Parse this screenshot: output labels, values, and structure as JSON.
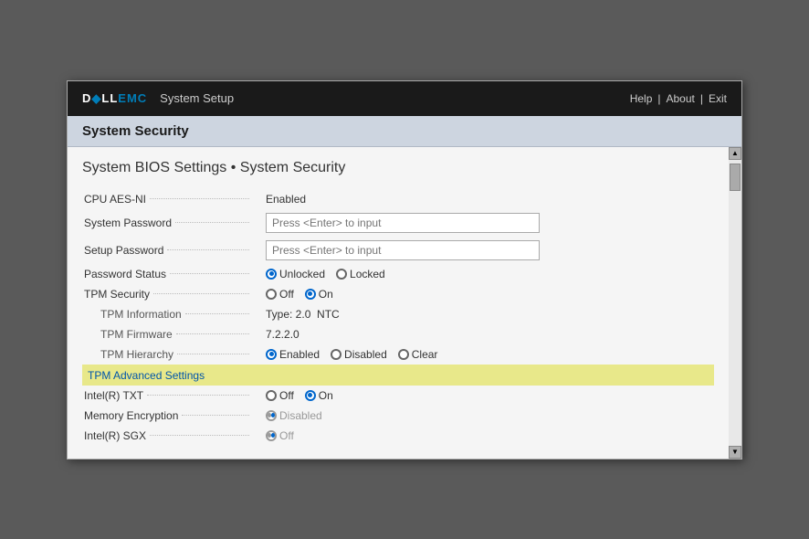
{
  "header": {
    "logo_dell": "DELL",
    "logo_emc": "EMC",
    "system_setup": "System Setup",
    "nav_help": "Help",
    "nav_about": "About",
    "nav_exit": "Exit"
  },
  "section_title": "System Security",
  "page_title": "System BIOS Settings • System Security",
  "settings": [
    {
      "id": "cpu-aes-ni",
      "label": "CPU AES-NI",
      "type": "text",
      "value": "Enabled",
      "indented": false,
      "disabled": false
    },
    {
      "id": "system-password",
      "label": "System Password",
      "type": "input",
      "placeholder": "Press <Enter> to input",
      "indented": false,
      "disabled": false
    },
    {
      "id": "setup-password",
      "label": "Setup Password",
      "type": "input",
      "placeholder": "Press <Enter> to input",
      "indented": false,
      "disabled": false
    },
    {
      "id": "password-status",
      "label": "Password Status",
      "type": "radio",
      "options": [
        {
          "label": "Unlocked",
          "selected": true
        },
        {
          "label": "Locked",
          "selected": false
        }
      ],
      "indented": false,
      "disabled": false
    },
    {
      "id": "tpm-security",
      "label": "TPM Security",
      "type": "radio",
      "options": [
        {
          "label": "Off",
          "selected": false
        },
        {
          "label": "On",
          "selected": true
        }
      ],
      "indented": false,
      "disabled": false
    },
    {
      "id": "tpm-information",
      "label": "TPM Information",
      "type": "text",
      "value": "Type: 2.0  NTC",
      "indented": true,
      "disabled": false
    },
    {
      "id": "tpm-firmware",
      "label": "TPM Firmware",
      "type": "text",
      "value": "7.2.2.0",
      "indented": true,
      "disabled": false
    },
    {
      "id": "tpm-hierarchy",
      "label": "TPM Hierarchy",
      "type": "radio",
      "options": [
        {
          "label": "Enabled",
          "selected": true
        },
        {
          "label": "Disabled",
          "selected": false
        },
        {
          "label": "Clear",
          "selected": false
        }
      ],
      "indented": true,
      "disabled": false
    },
    {
      "id": "tpm-advanced-settings",
      "label": "TPM Advanced Settings",
      "type": "link",
      "highlighted": true,
      "indented": false,
      "disabled": false
    },
    {
      "id": "intel-txt",
      "label": "Intel(R) TXT",
      "type": "radio",
      "options": [
        {
          "label": "Off",
          "selected": false
        },
        {
          "label": "On",
          "selected": true
        }
      ],
      "indented": false,
      "disabled": false
    },
    {
      "id": "memory-encryption",
      "label": "Memory Encryption",
      "type": "radio",
      "options": [
        {
          "label": "Disabled",
          "selected": true
        }
      ],
      "indented": false,
      "disabled": true
    },
    {
      "id": "intel-sgx",
      "label": "Intel(R) SGX",
      "type": "radio",
      "options": [
        {
          "label": "Off",
          "selected": true
        }
      ],
      "indented": false,
      "disabled": true
    }
  ]
}
